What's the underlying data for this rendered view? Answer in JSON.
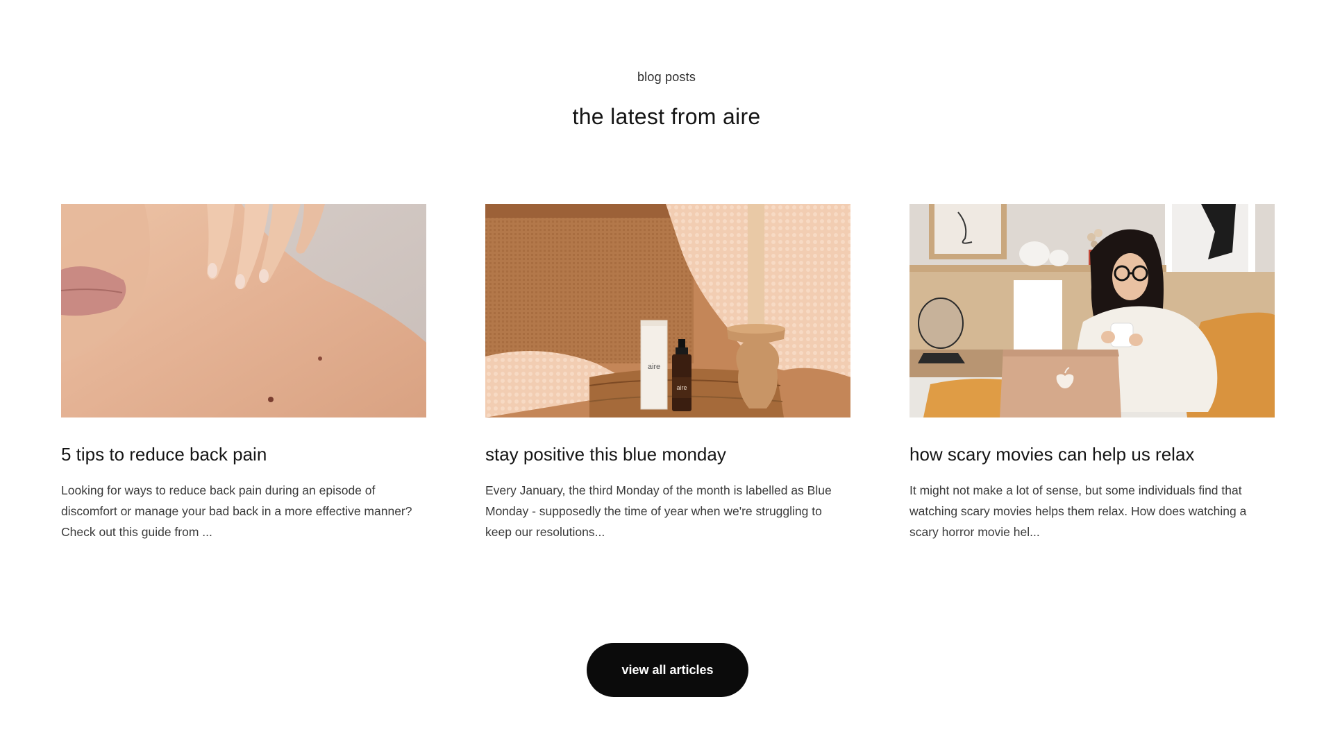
{
  "section": {
    "eyebrow": "blog posts",
    "heading": "the latest from aire"
  },
  "posts": [
    {
      "image_label": "photo of fingers touching a bare shoulder",
      "title": "5 tips to reduce back pain",
      "excerpt": "Looking for ways to reduce back pain during an episode of discomfort or manage your bad back in a more effective manner? Check out this guide from ..."
    },
    {
      "image_label": "aire product box and dropper bottle beside a candle on a tray",
      "product_box_text": "aire",
      "product_bottle_text": "aire",
      "title": "stay positive this blue monday",
      "excerpt": "Every January, the third Monday of the month is labelled as Blue Monday - supposedly the time of year when we're struggling to keep our resolutions..."
    },
    {
      "image_label": "woman with glasses holding a mug in front of a laptop",
      "title": "how scary movies can help us relax",
      "excerpt": "It might not make a lot of sense, but some individuals find that watching scary movies helps them relax. How does watching a scary horror movie hel..."
    }
  ],
  "cta": {
    "label": "view all articles"
  },
  "colors": {
    "background": "#ffffff",
    "text": "#151515",
    "button": "#0b0b0b",
    "button_text": "#ffffff"
  }
}
